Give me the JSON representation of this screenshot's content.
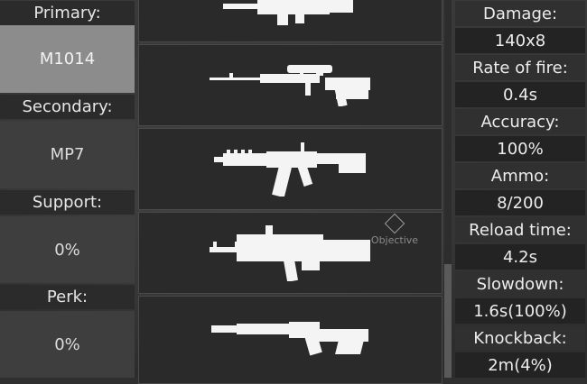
{
  "loadout": {
    "primary_label": "Primary:",
    "primary_value": "M1014",
    "secondary_label": "Secondary:",
    "secondary_value": "MP7",
    "support_label": "Support:",
    "support_value": "0%",
    "perk_label": "Perk:",
    "perk_value": "0%"
  },
  "weapon_list": [
    {
      "icon": "assault-rifle-icon"
    },
    {
      "icon": "sniper-rifle-icon"
    },
    {
      "icon": "carbine-rifle-icon"
    },
    {
      "icon": "auto-shotgun-icon"
    },
    {
      "icon": "pump-shotgun-icon"
    }
  ],
  "map_marker": {
    "label": "Objective",
    "icon": "objective-diamond-icon"
  },
  "stats": {
    "damage_label": "Damage:",
    "damage_value": "140x8",
    "rof_label": "Rate of fire:",
    "rof_value": "0.4s",
    "accuracy_label": "Accuracy:",
    "accuracy_value": "100%",
    "ammo_label": "Ammo:",
    "ammo_value": "8/200",
    "reload_label": "Reload time:",
    "reload_value": "4.2s",
    "slowdown_label": "Slowdown:",
    "slowdown_value": "1.6s(100%)",
    "knockback_label": "Knockback:",
    "knockback_value": "2m(4%)"
  },
  "colors": {
    "selected_slot": "#8c8c8c",
    "panel": "#2a2a2a",
    "text": "#ececec"
  }
}
